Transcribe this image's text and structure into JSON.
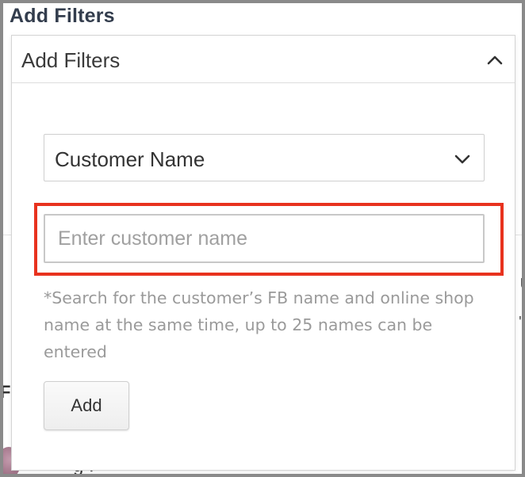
{
  "page_title": "Add Filters",
  "panel": {
    "header_label": "Add Filters",
    "header_icon": "chevron-up-icon",
    "expanded": true
  },
  "filter_select": {
    "selected": "Customer Name",
    "icon": "chevron-down-icon"
  },
  "customer_input": {
    "value": "",
    "placeholder": "Enter customer name"
  },
  "hint_text": "*Search for the customer’s FB name and online shop name at the same time, up to 25 names can be entered",
  "add_button_label": "Add",
  "highlight_color": "#e8321e",
  "background_fragments": {
    "right_top": "U",
    "right_mid": "'t",
    "left": "F",
    "bottom": "g :"
  }
}
